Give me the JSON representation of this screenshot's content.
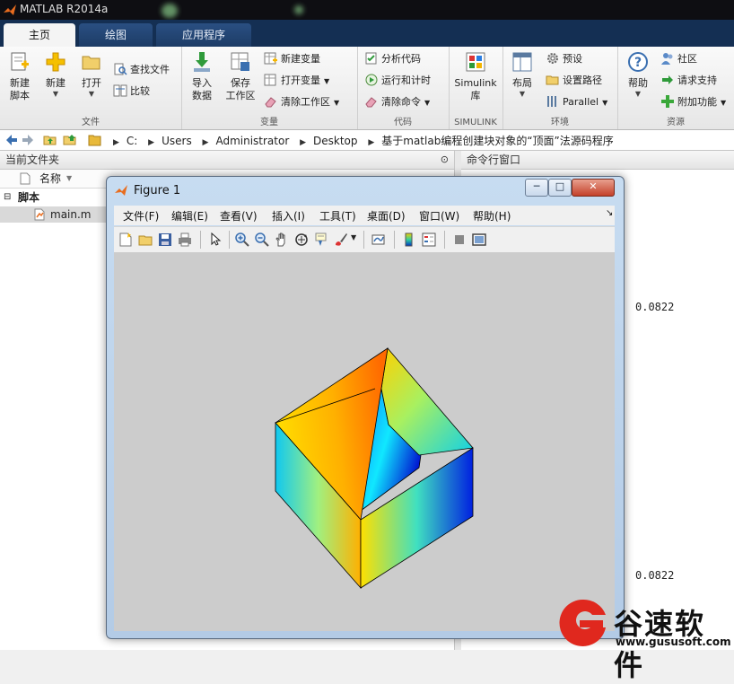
{
  "window": {
    "title": "MATLAB R2014a"
  },
  "ribbon_tabs": [
    {
      "label": "主页",
      "active": true
    },
    {
      "label": "绘图",
      "active": false
    },
    {
      "label": "应用程序",
      "active": false
    }
  ],
  "ribbon": {
    "file": {
      "group_label": "文件",
      "new_script": "新建\n脚本",
      "new": "新建",
      "open": "打开",
      "find_files": "查找文件",
      "compare": "比较"
    },
    "variable": {
      "group_label": "变量",
      "import_data": "导入\n数据",
      "save_workspace": "保存\n工作区",
      "new_variable": "新建变量",
      "open_variable": "打开变量",
      "clear_workspace": "清除工作区"
    },
    "code": {
      "group_label": "代码",
      "analyze_code": "分析代码",
      "run_and_time": "运行和计时",
      "clear_commands": "清除命令"
    },
    "simulink": {
      "group_label": "SIMULINK",
      "library": "Simulink\n库"
    },
    "environment": {
      "group_label": "环境",
      "layout": "布局",
      "preferences": "预设",
      "set_path": "设置路径",
      "parallel": "Parallel"
    },
    "resources": {
      "group_label": "资源",
      "help": "帮助",
      "community": "社区",
      "request_support": "请求支持",
      "addons": "附加功能"
    }
  },
  "address_bar": {
    "path": [
      "C:",
      "Users",
      "Administrator",
      "Desktop",
      "基于matlab编程创建块对象的“顶面”法源码程序"
    ]
  },
  "current_folder": {
    "title": "当前文件夹",
    "column_name": "名称",
    "group": "脚本",
    "files": [
      "main.m"
    ]
  },
  "command_window": {
    "title": "命令行窗口",
    "outputs": [
      "0.0822",
      "0.0822"
    ]
  },
  "figure": {
    "title": "Figure 1",
    "menu": [
      "文件(F)",
      "编辑(E)",
      "查看(V)",
      "插入(I)",
      "工具(T)",
      "桌面(D)",
      "窗口(W)",
      "帮助(H)"
    ],
    "buttons": {
      "minimize": "─",
      "maximize": "□",
      "close": "✕"
    }
  },
  "watermark": {
    "brand": "谷速软件",
    "url": "www.gususoft.com"
  },
  "colors": {
    "tabbar": "#142f53",
    "plot_background": "#cccccc",
    "watermark_red": "#e0281e"
  }
}
